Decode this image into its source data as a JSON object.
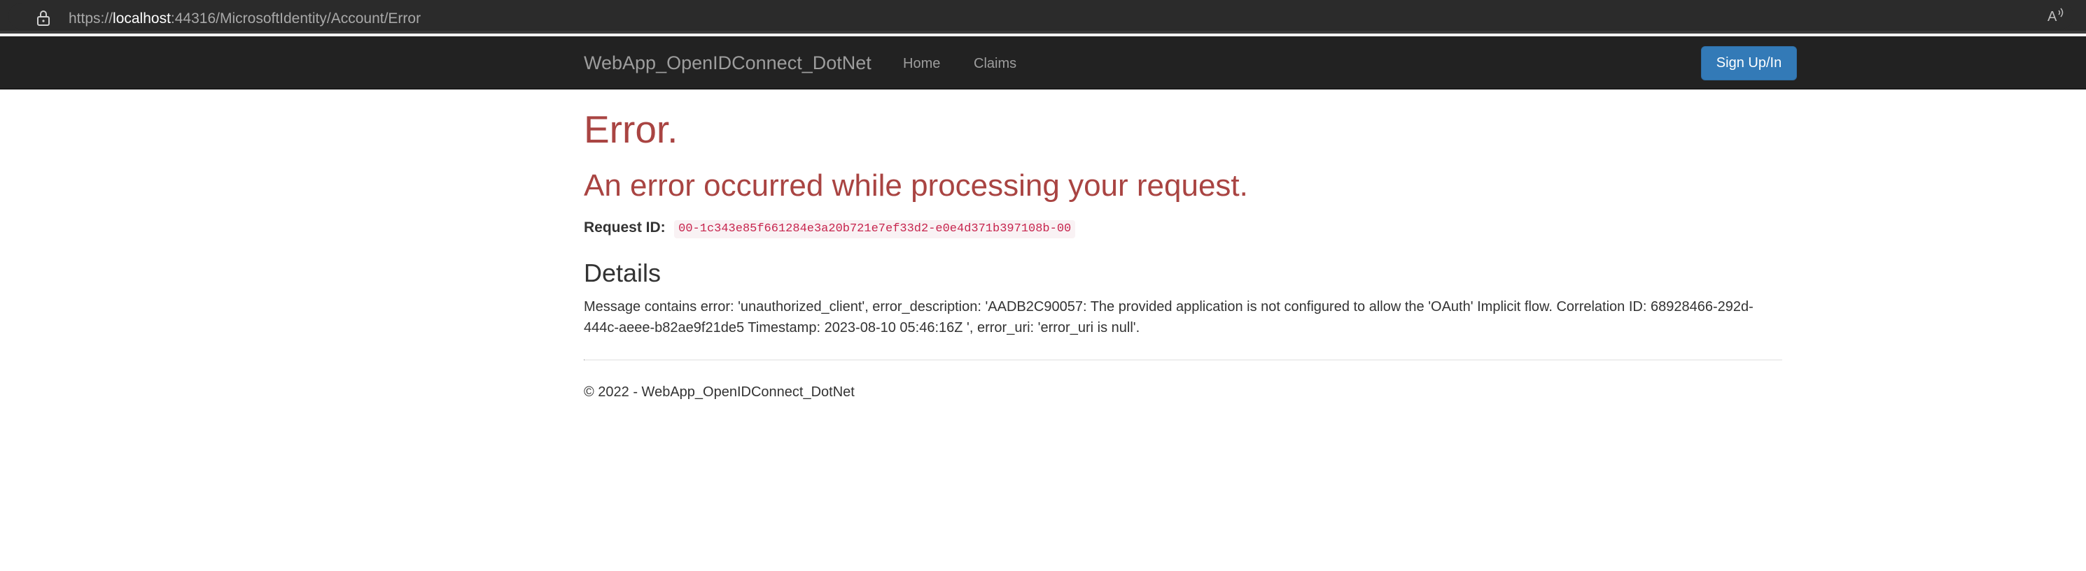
{
  "browser": {
    "url_scheme": "https://",
    "url_host": "localhost",
    "url_rest": ":44316/MicrosoftIdentity/Account/Error",
    "read_aloud_icon": "read-aloud-icon",
    "lock_icon": "lock-icon"
  },
  "navbar": {
    "brand": "WebApp_OpenIDConnect_DotNet",
    "links": [
      {
        "label": "Home"
      },
      {
        "label": "Claims"
      }
    ],
    "signup_label": "Sign Up/In"
  },
  "main": {
    "title": "Error.",
    "subtitle": "An error occurred while processing your request.",
    "request_id_label": "Request ID:",
    "request_id_value": "00-1c343e85f661284e3a20b721e7ef33d2-e0e4d371b397108b-00",
    "details_heading": "Details",
    "details_message": "Message contains error: 'unauthorized_client', error_description: 'AADB2C90057: The provided application is not configured to allow the 'OAuth' Implicit flow. Correlation ID: 68928466-292d-444c-aeee-b82ae9f21de5 Timestamp: 2023-08-10 05:46:16Z ', error_uri: 'error_uri is null'."
  },
  "footer": {
    "text": "© 2022 - WebApp_OpenIDConnect_DotNet"
  },
  "colors": {
    "navbar_bg": "#222222",
    "browser_bg": "#2b2b2b",
    "error_red": "#a94442",
    "primary_button": "#337ab7",
    "code_pink": "#c7254e"
  }
}
